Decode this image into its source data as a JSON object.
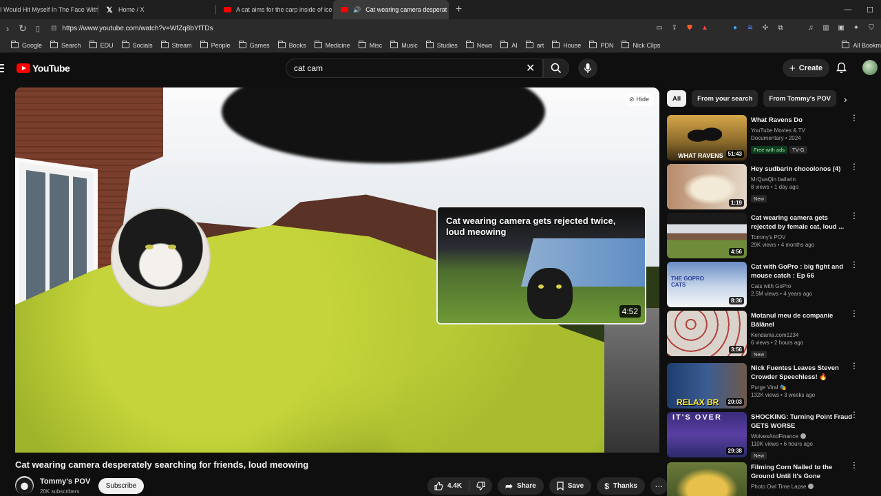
{
  "browser": {
    "tabs": [
      {
        "title": "I Would Hit Myself In The Face With"
      },
      {
        "title": "Home / X"
      },
      {
        "title": "A cat aims for the carp inside of ice -"
      },
      {
        "title": "Cat wearing camera desperat"
      }
    ],
    "url": "https://www.youtube.com/watch?v=WfZq8bYfTDs",
    "bookmarks": [
      "Google",
      "Search",
      "EDU",
      "Socials",
      "Stream",
      "People",
      "Games",
      "Books",
      "Medicine",
      "Misc",
      "Music",
      "Studies",
      "News",
      "AI",
      "art",
      "House",
      "PDN",
      "Nick Clips"
    ],
    "bookmarks_right": "All Bookm"
  },
  "youtube": {
    "logo": "YouTube",
    "search_value": "cat cam",
    "create_label": "Create"
  },
  "player": {
    "hide_label": "Hide",
    "endcard_title": "Cat wearing camera gets rejected twice, loud meowing",
    "endcard_duration": "4:52"
  },
  "video": {
    "title": "Cat wearing camera desperately searching for friends, loud meowing",
    "channel": "Tommy's POV",
    "subscribers": "20K subscribers",
    "subscribe_label": "Subscribe",
    "likes": "4.4K",
    "share_label": "Share",
    "save_label": "Save",
    "thanks_label": "Thanks"
  },
  "chips": [
    "All",
    "From your search",
    "From Tommy's POV"
  ],
  "recommendations": [
    {
      "title": "What Ravens Do",
      "channel": "YouTube Movies & TV",
      "stats": "Documentary • 2024",
      "duration": "51:43",
      "badges": [
        "Free with ads",
        "TV-G"
      ],
      "thumb_text": "WHAT RAVENS"
    },
    {
      "title": "Hey sudbarin chocolonos (4)",
      "channel": "MrQuaQin bailarin",
      "stats": "8 views • 1 day ago",
      "duration": "1:19",
      "badges": [
        "New"
      ]
    },
    {
      "title": "Cat wearing camera gets rejected by female cat, loud ...",
      "channel": "Tommy's POV",
      "stats": "29K views • 4 months ago",
      "duration": "4:56",
      "badges": []
    },
    {
      "title": "Cat with GoPro : big fight and mouse catch : Ep 66",
      "channel": "Cats with GoPro",
      "stats": "2.5M views • 4 years ago",
      "duration": "8:36",
      "badges": [],
      "thumb_text": "THE GOPRO CATS"
    },
    {
      "title": "Motanul meu de companie Bălănel",
      "channel": "Kendama.com1234",
      "stats": "6 views • 2 hours ago",
      "duration": "3:56",
      "badges": [
        "New"
      ]
    },
    {
      "title": "Nick Fuentes Leaves Steven Crowder Speechless! 🔥",
      "channel": "Purge Viral 🎭",
      "stats": "132K views • 3 weeks ago",
      "duration": "20:03",
      "badges": [],
      "thumb_text": "RELAX BR"
    },
    {
      "title": "SHOCKING: Turning Point Fraud GETS WORSE",
      "channel": "WolvesAndFinance",
      "stats": "110K views • 6 hours ago",
      "duration": "29:38",
      "badges": [
        "New"
      ],
      "thumb_text": "IT'S OVER"
    },
    {
      "title": "Filming Corn Nailed to the Ground Until It's Gone",
      "channel": "Photo Owl Time Lapse",
      "stats": "",
      "duration": "",
      "badges": []
    }
  ]
}
